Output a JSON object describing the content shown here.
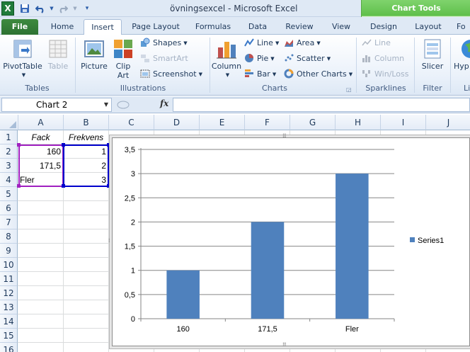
{
  "window": {
    "title": "övningsexcel  -  Microsoft Excel",
    "app_icon_letter": "X",
    "chart_tools_label": "Chart Tools"
  },
  "quick_access": {
    "save_icon": "save-icon",
    "undo_icon": "undo-icon",
    "redo_icon": "redo-icon",
    "customize_icon": "customize-icon"
  },
  "tabs": {
    "file": "File",
    "home": "Home",
    "insert": "Insert",
    "page_layout": "Page Layout",
    "formulas": "Formulas",
    "data": "Data",
    "review": "Review",
    "view": "View",
    "design": "Design",
    "layout": "Layout",
    "format": "Fo"
  },
  "ribbon": {
    "tables": {
      "label": "Tables",
      "pivottable": "PivotTable",
      "table": "Table"
    },
    "illustrations": {
      "label": "Illustrations",
      "picture": "Picture",
      "clip_art_1": "Clip",
      "clip_art_2": "Art",
      "shapes": "Shapes",
      "smartart": "SmartArt",
      "screenshot": "Screenshot"
    },
    "charts": {
      "label": "Charts",
      "column": "Column",
      "line": "Line",
      "pie": "Pie",
      "bar": "Bar",
      "area": "Area",
      "scatter": "Scatter",
      "other": "Other Charts"
    },
    "sparklines": {
      "label": "Sparklines",
      "line": "Line",
      "column": "Column",
      "winloss": "Win/Loss"
    },
    "filter": {
      "label": "Filter",
      "slicer": "Slicer"
    },
    "links": {
      "label": "Li",
      "hyperlink": "Hyp"
    }
  },
  "formula_bar": {
    "name_box": "Chart 2",
    "fx": "fx",
    "formula": ""
  },
  "sheet": {
    "columns": [
      "A",
      "B",
      "C",
      "D",
      "E",
      "F",
      "G",
      "H",
      "I",
      "J"
    ],
    "rows": [
      "1",
      "2",
      "3",
      "4",
      "5",
      "6",
      "7",
      "8",
      "9",
      "10",
      "11",
      "12",
      "13",
      "14",
      "15",
      "16"
    ],
    "cells": {
      "A1": "Fack",
      "B1": "Frekvens",
      "A2": "160",
      "B2": "1",
      "A3": "171,5",
      "B3": "2",
      "A4": "Fler",
      "B4": "3"
    }
  },
  "chart_data": {
    "type": "bar",
    "categories": [
      "160",
      "171,5",
      "Fler"
    ],
    "series": [
      {
        "name": "Series1",
        "values": [
          1,
          2,
          3
        ],
        "color": "#4f81bd"
      }
    ],
    "yticks": [
      "0",
      "0,5",
      "1",
      "1,5",
      "2",
      "2,5",
      "3",
      "3,5"
    ],
    "ylim": [
      0,
      3.5
    ],
    "grid": true,
    "legend": "right",
    "title": "",
    "xlabel": "",
    "ylabel": ""
  },
  "colors": {
    "bar": "#4f81bd",
    "gridline": "#868686",
    "selection_purple": "#a020c0",
    "selection_blue": "#0000cc"
  }
}
